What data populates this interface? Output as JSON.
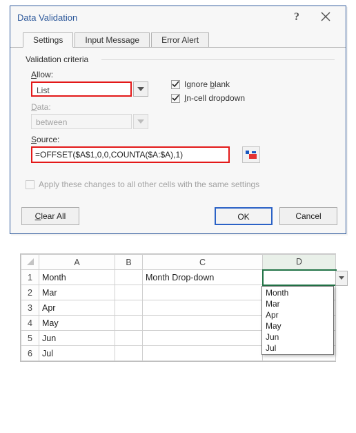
{
  "dialog": {
    "title": "Data Validation",
    "tabs": {
      "settings": "Settings",
      "inputMessage": "Input Message",
      "errorAlert": "Error Alert"
    },
    "legend": "Validation criteria",
    "allowLabel": "Allow:",
    "allowValue": "List",
    "dataLabel": "Data:",
    "dataValue": "between",
    "ignoreBlankLabel": "Ignore blank",
    "inCellLabel": "In-cell dropdown",
    "sourceLabel": "Source:",
    "sourceValue": "=OFFSET($A$1,0,0,COUNTA($A:$A),1)",
    "applyLabel": "Apply these changes to all other cells with the same settings",
    "clearAll": "Clear All",
    "ok": "OK",
    "cancel": "Cancel"
  },
  "sheet": {
    "headers": {
      "A": "A",
      "B": "B",
      "C": "C",
      "D": "D"
    },
    "rows": {
      "1": {
        "num": "1",
        "A": "Month",
        "C": "Month Drop-down"
      },
      "2": {
        "num": "2",
        "A": "Mar"
      },
      "3": {
        "num": "3",
        "A": "Apr"
      },
      "4": {
        "num": "4",
        "A": "May"
      },
      "5": {
        "num": "5",
        "A": "Jun"
      },
      "6": {
        "num": "6",
        "A": "Jul"
      }
    },
    "dropdown": [
      "Month",
      "Mar",
      "Apr",
      "May",
      "Jun",
      "Jul"
    ]
  }
}
